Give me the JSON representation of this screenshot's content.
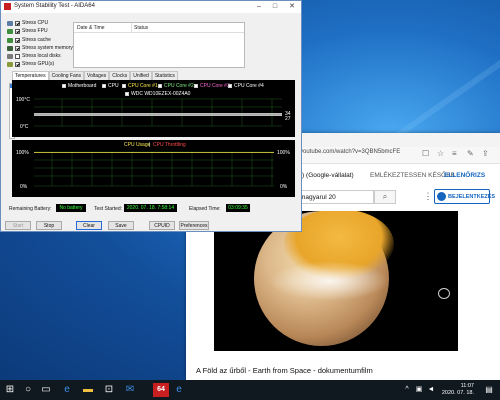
{
  "aida": {
    "title": "System Stability Test - AIDA64",
    "stress_items": [
      {
        "label": "Stress CPU",
        "checked": true,
        "color": "#5a7ca6"
      },
      {
        "label": "Stress FPU",
        "checked": true,
        "color": "#3e8e3e"
      },
      {
        "label": "Stress cache",
        "checked": true,
        "color": "#3e8e3e"
      },
      {
        "label": "Stress system memory",
        "checked": true,
        "color": "#3a5e3a"
      },
      {
        "label": "Stress local disks",
        "checked": false,
        "color": "#7a7a7a"
      },
      {
        "label": "Stress GPU(s)",
        "checked": true,
        "color": "#8a9a3a"
      }
    ],
    "event_log_headers": {
      "date_time": "Date & Time",
      "status": "Status"
    },
    "tabs": [
      "Temperatures",
      "Cooling Fans",
      "Voltages",
      "Clocks",
      "Unified",
      "Statistics"
    ],
    "active_tab": "Temperatures",
    "temp_legend": [
      "Motherboard",
      "CPU",
      "CPU Core #1",
      "CPU Core #2",
      "CPU Core #3",
      "CPU Core #4",
      "WDC WD10EZEX-00Z4A0"
    ],
    "temp_axis": {
      "top": "100°C",
      "bottom": "0°C"
    },
    "temp_right_values": [
      "34",
      "27"
    ],
    "usage_legend": {
      "cpu_usage": "CPU Usage",
      "separator": "|",
      "throttling": "CPU Throttling"
    },
    "usage_axis": {
      "top_left": "100%",
      "bottom_left": "0%",
      "top_right": "100%",
      "bottom_right": "0%"
    },
    "status": {
      "remaining_battery_label": "Remaining Battery:",
      "remaining_battery_value": "No battery",
      "test_started_label": "Test Started:",
      "test_started_value": "2020. 07. 18. 7:58:14",
      "elapsed_label": "Elapsed Time:",
      "elapsed_value": "03:09:35"
    },
    "buttons": {
      "start": "Start",
      "stop": "Stop",
      "clear": "Clear",
      "save": "Save",
      "cpuid": "CPUID",
      "preferences": "Preferences"
    }
  },
  "browser": {
    "url": "youtube.com/watch?v=3QBN5bmcFE",
    "channel_label": "ló) (Google-vállalat)",
    "remind_later": "EMLÉKEZTESSEN KÉSŐBB",
    "check": "ELLENŐRIZS",
    "search_value": "magyarul 20",
    "sign_in": "BEJELENTKEZÉS",
    "video_title": "A Föld az űrből - Earth from Space - dokumentumfilm"
  },
  "taskbar": {
    "time": "11:07",
    "date": "2020. 07. 18."
  }
}
